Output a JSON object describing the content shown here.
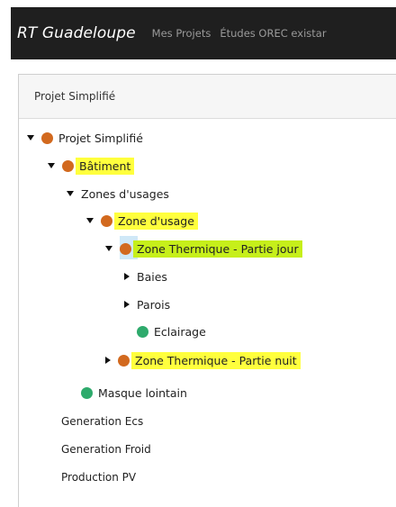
{
  "navbar": {
    "brand": "RT Guadeloupe",
    "links": [
      "Mes Projets",
      "Études OREC existar"
    ]
  },
  "panel": {
    "title": "Projet Simplifié"
  },
  "tree": {
    "projet": "Projet Simplifié",
    "batiment": "Bâtiment",
    "zones_usages": "Zones d'usages",
    "zone_usage": "Zone d'usage",
    "zone_jour": "Zone Thermique - Partie jour",
    "baies": "Baies",
    "parois": "Parois",
    "eclairage": "Eclairage",
    "zone_nuit": "Zone Thermique - Partie nuit",
    "masque": "Masque lointain",
    "gen_ecs": "Generation Ecs",
    "gen_froid": "Generation Froid",
    "prod_pv": "Production PV"
  },
  "colors": {
    "status_orange": "#d2691e",
    "status_green": "#2eaa6c",
    "highlight_yellow": "#ffff3d",
    "highlight_green": "#c6ef1a",
    "navbar_bg": "#1f1f1f"
  },
  "icons": {
    "expanded": "caret-down-icon",
    "collapsed": "caret-right-icon",
    "status": "status-dot-icon"
  }
}
